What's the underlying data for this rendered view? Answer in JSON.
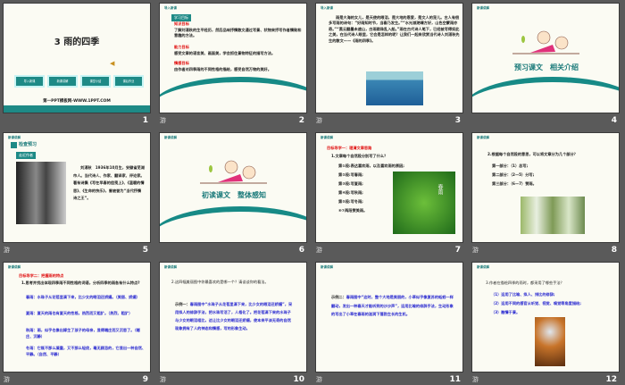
{
  "slides": [
    {
      "number": "1",
      "title": "3 雨的四季",
      "nav": [
        "导入新课",
        "新课讲解",
        "课堂小结",
        "课后作业"
      ],
      "footer": "第一PPT模板网-WWW.1PPT.COM"
    },
    {
      "number": "2",
      "header": "导入新课",
      "box": "学习目标",
      "h1": "知识目标",
      "p1": "了解刘湛秋的生平经历，然后品味抒情散文通过写景、状物来抒写作者情致和意趣的方法。",
      "h2": "能力目标",
      "p2": "感受文章的语言美、画面美，学会抓住景物特征的描写方法。",
      "h3": "情感目标",
      "p3": "由作者对四季雨的不同性格的描绘，感受自然万物的美好。"
    },
    {
      "number": "3",
      "header": "导入新课",
      "p": "雨是大海的女儿，是天使的眼泪，是大地的恩爱，是文人的宠儿。古人有很多写雨的诗句：“好雨知时节，当春乃发生。”“水光潋滟晴方好，山色空蒙雨亦奇。”“黑云翻墨未遮山，白雨跳珠乱入船。”雨在古代诗人笔下，已经被写得如此之美，在当代诗人眼里，它会是怎样的呢？让我们一起来欣赏当代诗人刘湛秋先生的散文——《雨的四季》。"
    },
    {
      "number": "4",
      "header": "新课讲解",
      "title": "预习课文　相关介绍"
    },
    {
      "number": "5",
      "header": "新课讲解",
      "section": "检查预习",
      "box": "走近作者",
      "p": "刘湛秋　1936年10月生，安徽省芜湖市人。当代诗人、作家、翻译家、评论家。著有诗集《写在早春的信笺上》、《温暖的情思》、《生命的快乐》，曾被誉为“当代抒情诗之王”。"
    },
    {
      "number": "6",
      "header": "新课讲解",
      "title": "初读课文　整体感知"
    },
    {
      "number": "7",
      "header": "新课讲解",
      "h": "目标导学一：理清文章思路",
      "q": "1.文章每个自然段分别写了什么？",
      "items": [
        "第①段:表达喜欢雨，以及喜欢雨的原因;",
        "第②段:写春雨;",
        "第③段:写夏雨;",
        "第④段:写秋雨;",
        "第⑤段:写冬雨;",
        "⑥⑦两段赞美雨。"
      ],
      "img_text": "春雨"
    },
    {
      "number": "8",
      "header": "新课讲解",
      "q": "2.根据每个自然段的意思，可以将文章分为几个部分？",
      "items": [
        "第一部分：（1）总写;",
        "第二部分：（2—5）分写;",
        "第三部分：（6—7）赞雨。"
      ]
    },
    {
      "number": "9",
      "header": "新课讲解",
      "h": "目标导学二：把握雨的特点",
      "q": "1.思考并找出体现四季雨不同性格的词语，分析四季的雨各有什么特点?",
      "items": [
        "春雨：水珠子从花苞里滴下来，比少女的眼泪还娇媚。（美丽、娇媚）",
        "夏雨：夏天的雨也有夏天的性格，热烈而又粗犷。（热烈、粗犷）",
        "秋雨：雨，似乎也像出嫁生了孩子的母亲，显得端庄而又沉思了。（端庄、沉静）",
        "冬雨：它既不那么凝重，又不那么轻佻，毫无顾忌的，它显出一种自然、平静。（自然、平静）"
      ]
    },
    {
      "number": "10",
      "header": "新课讲解",
      "q": "2.这四幅美丽图中你最喜欢的是哪一个？请谈谈你的看法。",
      "label": "示例一：",
      "p": "春雨图中“水珠子从花苞里滴下来，比少女的眼泪还娇媚”，采用拟人的修辞手法，把水珠写活了，人格化了。把花苞滴下来的水珠子与少女的眼泪相比，这让比少女的眼泪还娇媚，使本来平淡无奇的自然现象拥有了人的神态和情感，写的形象生动。"
    },
    {
      "number": "11",
      "header": "新课讲解",
      "label": "示例二：",
      "p": "春雨图中“这时，整个大地是美丽的，小草似乎像复苏的蚯蚓一样翻动，发出一种春天才能听到的沙沙声”，运用比喻的修辞手法，生动形象的写出了小草在春雨的滋润下蓬勃生长的生机。"
    },
    {
      "number": "12",
      "header": "新课讲解",
      "q": "3.作者在描绘四季的雨时，都采用了哪些手法？",
      "items": [
        "（1）运用了比喻、拟人、排比的修辞;",
        "（2）运用不同的感官从听觉、视觉、嗅觉等角度描绘;",
        "（3）融情于景。"
      ]
    }
  ],
  "animation_icon": "游"
}
